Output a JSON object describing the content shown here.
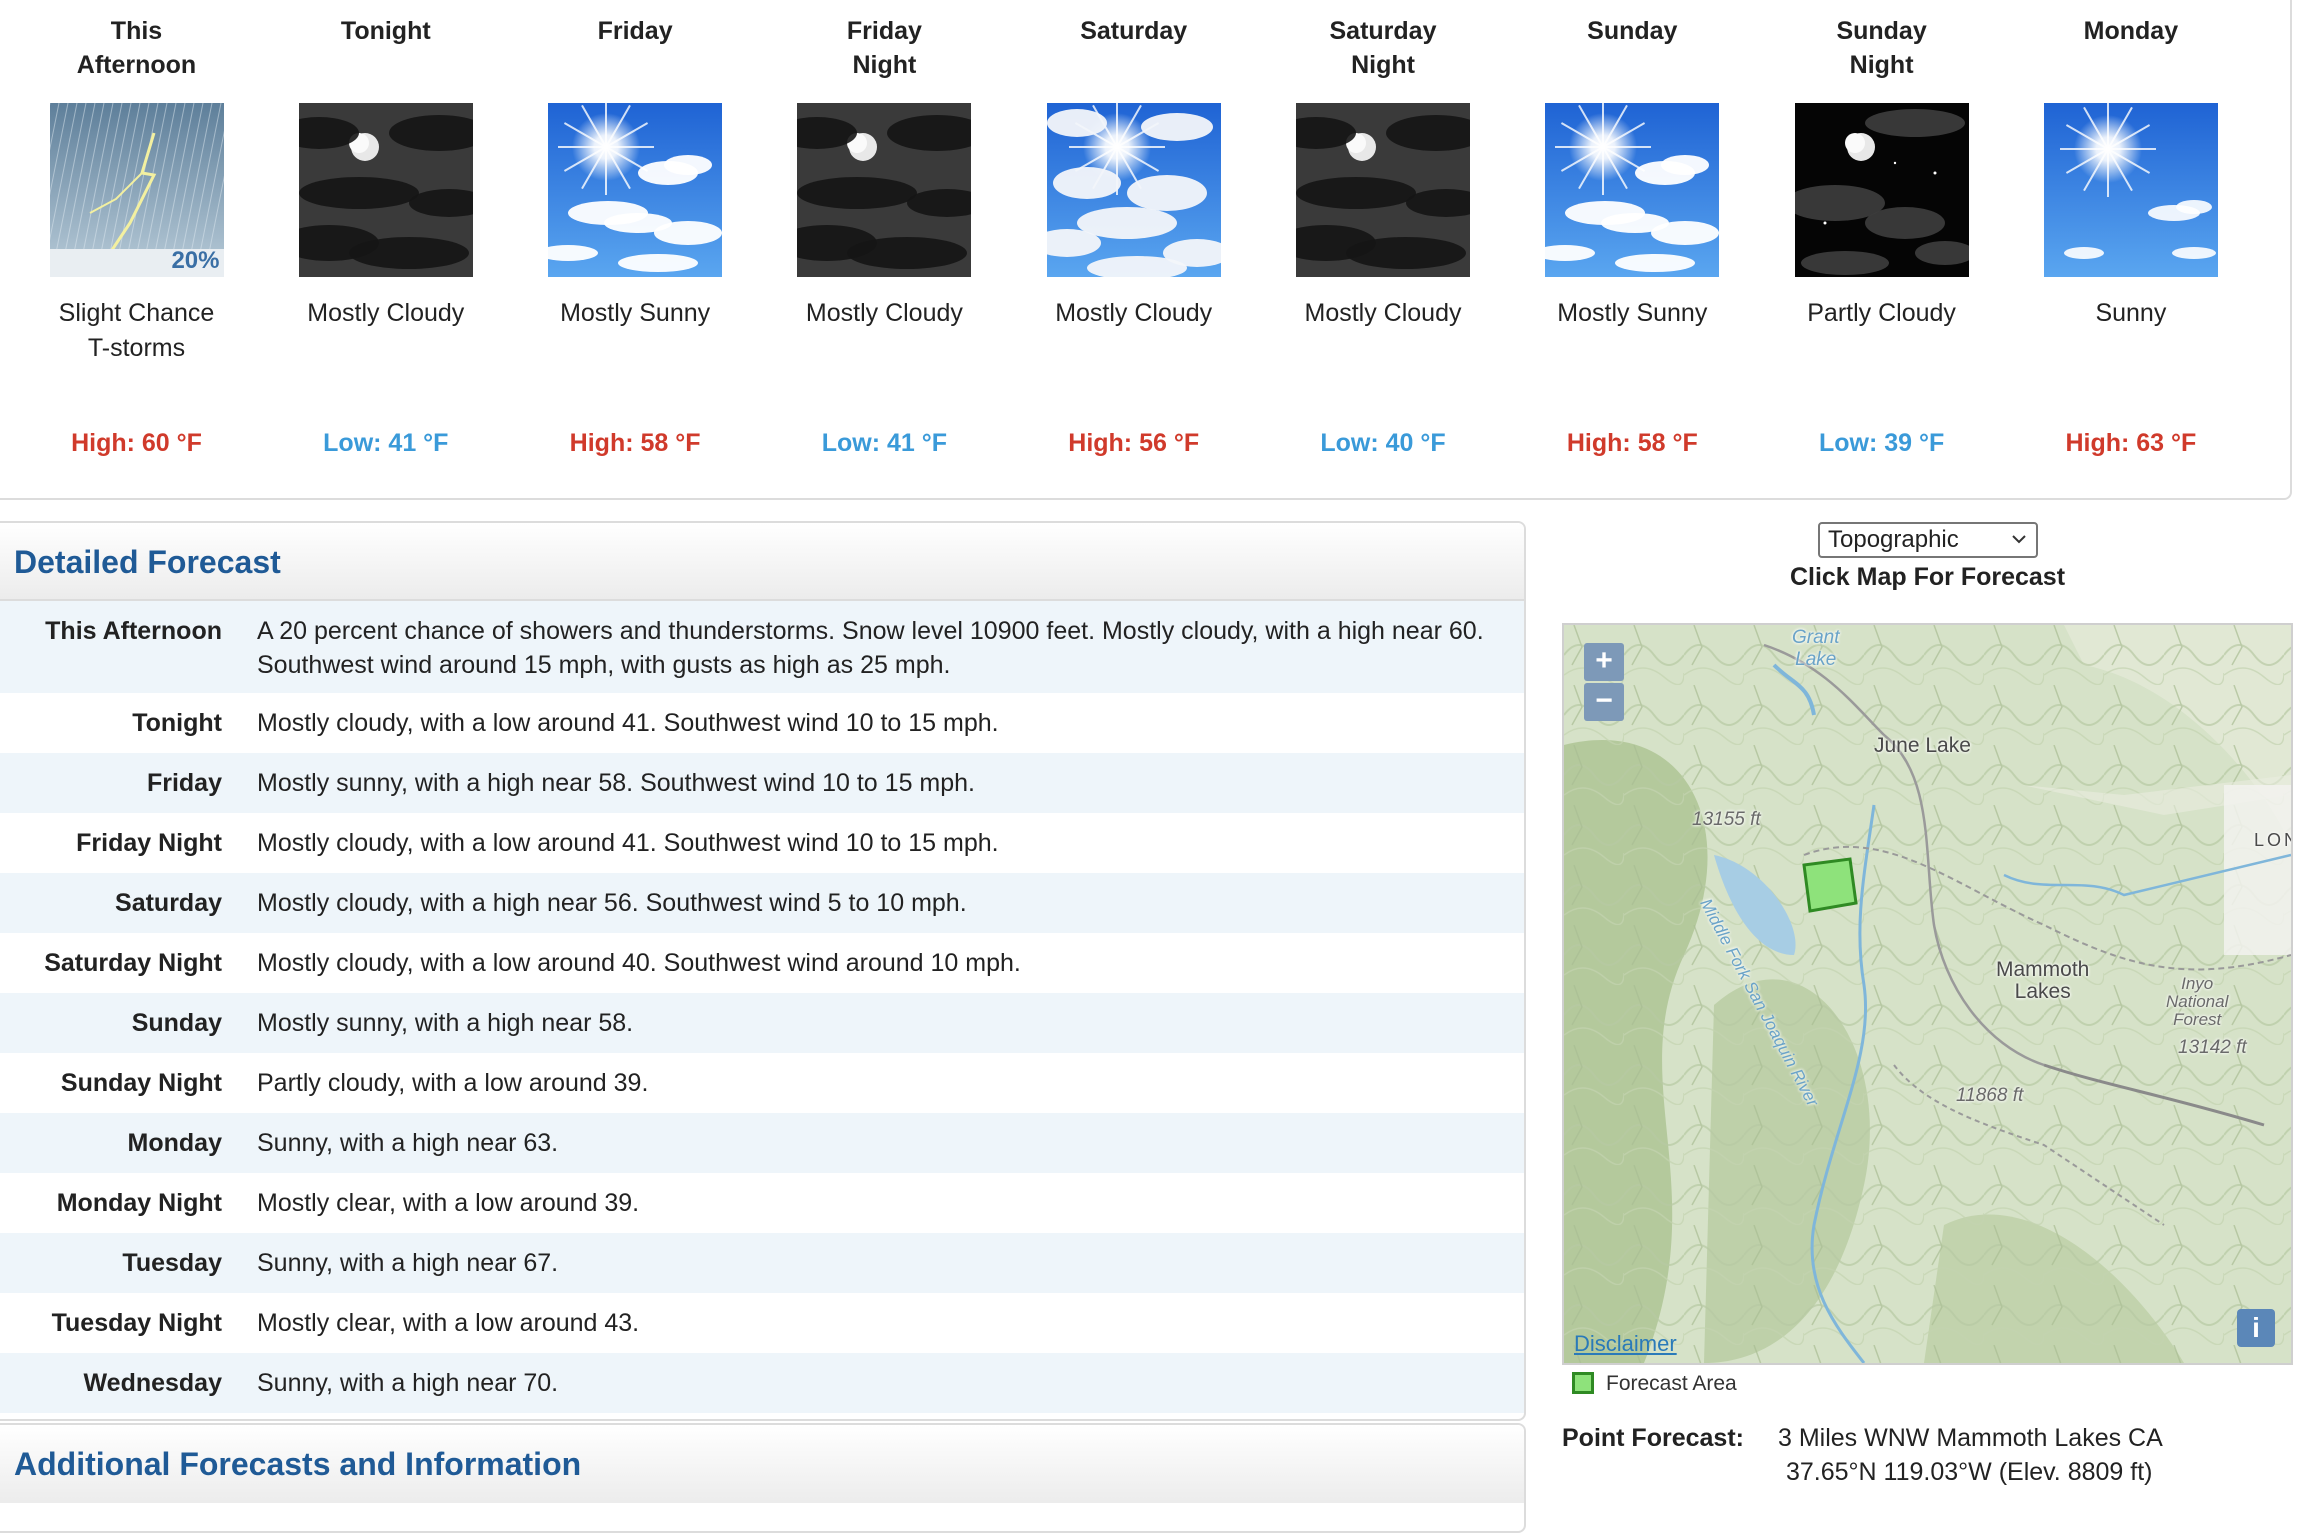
{
  "periods": [
    {
      "name": "This\nAfternoon",
      "desc": "Slight Chance\nT-storms",
      "temp": "High: 60 °F",
      "kind": "high",
      "icon": "tstorm-icon",
      "pop": "20%"
    },
    {
      "name": "Tonight",
      "desc": "Mostly Cloudy",
      "temp": "Low: 41 °F",
      "kind": "low",
      "icon": "night-mostly-cloudy-icon"
    },
    {
      "name": "Friday",
      "desc": "Mostly Sunny",
      "temp": "High: 58 °F",
      "kind": "high",
      "icon": "mostly-sunny-icon"
    },
    {
      "name": "Friday\nNight",
      "desc": "Mostly Cloudy",
      "temp": "Low: 41 °F",
      "kind": "low",
      "icon": "night-mostly-cloudy-icon"
    },
    {
      "name": "Saturday",
      "desc": "Mostly Cloudy",
      "temp": "High: 56 °F",
      "kind": "high",
      "icon": "mostly-cloudy-icon"
    },
    {
      "name": "Saturday\nNight",
      "desc": "Mostly Cloudy",
      "temp": "Low: 40 °F",
      "kind": "low",
      "icon": "night-mostly-cloudy-icon"
    },
    {
      "name": "Sunday",
      "desc": "Mostly Sunny",
      "temp": "High: 58 °F",
      "kind": "high",
      "icon": "mostly-sunny-icon"
    },
    {
      "name": "Sunday\nNight",
      "desc": "Partly Cloudy",
      "temp": "Low: 39 °F",
      "kind": "low",
      "icon": "night-partly-cloudy-icon"
    },
    {
      "name": "Monday",
      "desc": "Sunny",
      "temp": "High: 63 °F",
      "kind": "high",
      "icon": "sunny-icon"
    }
  ],
  "detailed": {
    "title": "Detailed Forecast",
    "rows": [
      {
        "label": "This Afternoon",
        "text": "A 20 percent chance of showers and thunderstorms. Snow level 10900 feet. Mostly cloudy, with a high near 60. Southwest wind around 15 mph, with gusts as high as 25 mph."
      },
      {
        "label": "Tonight",
        "text": "Mostly cloudy, with a low around 41. Southwest wind 10 to 15 mph."
      },
      {
        "label": "Friday",
        "text": "Mostly sunny, with a high near 58. Southwest wind 10 to 15 mph."
      },
      {
        "label": "Friday Night",
        "text": "Mostly cloudy, with a low around 41. Southwest wind 10 to 15 mph."
      },
      {
        "label": "Saturday",
        "text": "Mostly cloudy, with a high near 56. Southwest wind 5 to 10 mph."
      },
      {
        "label": "Saturday Night",
        "text": "Mostly cloudy, with a low around 40. Southwest wind around 10 mph."
      },
      {
        "label": "Sunday",
        "text": "Mostly sunny, with a high near 58."
      },
      {
        "label": "Sunday Night",
        "text": "Partly cloudy, with a low around 39."
      },
      {
        "label": "Monday",
        "text": "Sunny, with a high near 63."
      },
      {
        "label": "Monday Night",
        "text": "Mostly clear, with a low around 39."
      },
      {
        "label": "Tuesday",
        "text": "Sunny, with a high near 67."
      },
      {
        "label": "Tuesday Night",
        "text": "Mostly clear, with a low around 43."
      },
      {
        "label": "Wednesday",
        "text": "Sunny, with a high near 70."
      }
    ]
  },
  "additional": {
    "title": "Additional Forecasts and Information"
  },
  "map": {
    "layer_selected": "Topographic",
    "caption": "Click Map For Forecast",
    "zoom_in": "+",
    "zoom_out": "−",
    "labels": {
      "grant_lake": "Grant\nLake",
      "june_lake": "June Lake",
      "mammoth_lakes": "Mammoth\nLakes",
      "river": "Middle Fork San Joaquin River",
      "peak1": "13155 ft",
      "peak2": "13142 ft",
      "peak3": "11868 ft",
      "inyo": "Inyo\nNational\nForest",
      "edge": "LON"
    },
    "disclaimer": "Disclaimer",
    "info": "i",
    "legend": "Forecast Area"
  },
  "point_forecast": {
    "label": "Point Forecast:",
    "location": "3 Miles WNW Mammoth Lakes CA",
    "coords": "37.65°N 119.03°W (Elev. 8809 ft)"
  },
  "colors": {
    "high": "#d03a2b",
    "low": "#3a9ad9",
    "heading": "#1f5a96",
    "forecast_area": "#8ee27b"
  }
}
